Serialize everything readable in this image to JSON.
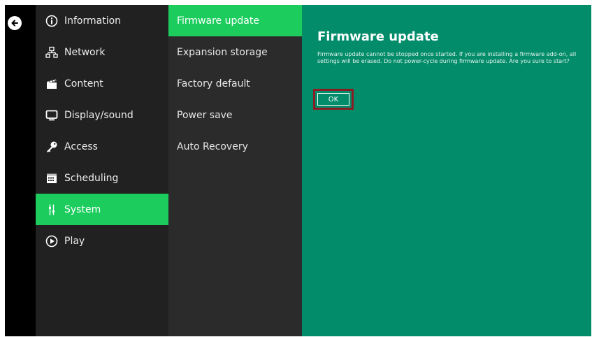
{
  "navigation": {
    "back_icon": "arrow-left-circle-icon"
  },
  "menu": {
    "items": [
      {
        "label": "Information",
        "icon": "info-icon"
      },
      {
        "label": "Network",
        "icon": "network-icon"
      },
      {
        "label": "Content",
        "icon": "clapperboard-icon"
      },
      {
        "label": "Display/sound",
        "icon": "monitor-icon"
      },
      {
        "label": "Access",
        "icon": "key-icon"
      },
      {
        "label": "Scheduling",
        "icon": "calendar-icon"
      },
      {
        "label": "System",
        "icon": "system-icon",
        "active": true
      },
      {
        "label": "Play",
        "icon": "play-icon"
      }
    ]
  },
  "submenu": {
    "items": [
      {
        "label": "Firmware update",
        "active": true
      },
      {
        "label": "Expansion storage"
      },
      {
        "label": "Factory default"
      },
      {
        "label": "Power save"
      },
      {
        "label": "Auto Recovery"
      }
    ]
  },
  "content": {
    "title": "Firmware update",
    "message": "Firmware update cannot be stopped once started. If you are installing a firmware add-on, all settings will be erased. Do not power-cycle during firmware update. Are you sure to start?",
    "ok_label": "OK"
  },
  "colors": {
    "accent": "#1ccd5e",
    "panel": "#028c6a",
    "menu_bg": "#212121",
    "submenu_bg": "#2b2b2b",
    "highlight": "#8b1e24"
  }
}
